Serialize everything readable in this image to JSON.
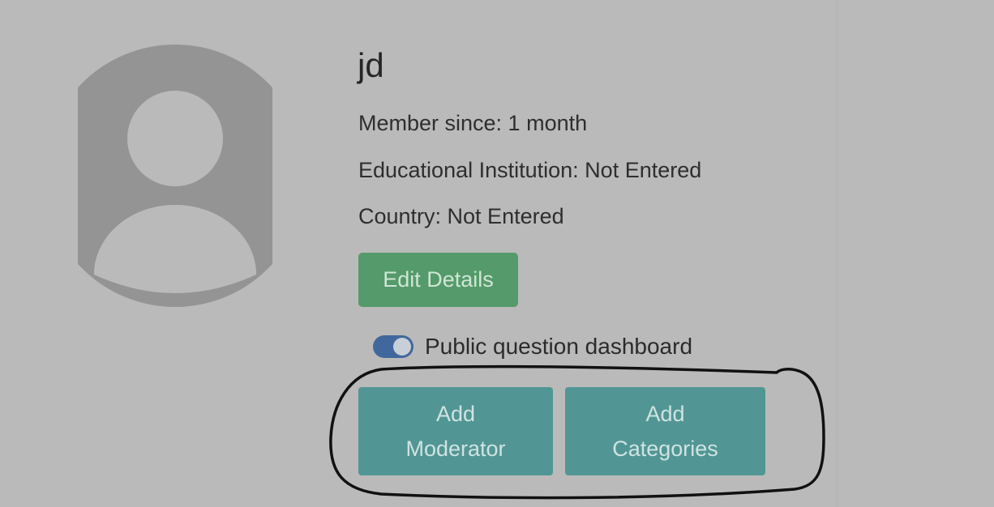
{
  "profile": {
    "username": "jd",
    "member_since": "Member since: 1 month",
    "institution": "Educational Institution: Not Entered",
    "country": "Country: Not Entered"
  },
  "buttons": {
    "edit_details": "Edit Details",
    "add_moderator_line1": "Add",
    "add_moderator_line2": "Moderator",
    "add_categories_line1": "Add",
    "add_categories_line2": "Categories"
  },
  "toggle": {
    "label": "Public question dashboard",
    "state": "on"
  },
  "icons": {
    "avatar": "user-silhouette-icon"
  },
  "colors": {
    "background": "#bababa",
    "edit_button": "#559a6a",
    "action_button": "#519694",
    "toggle_on": "#41689c"
  }
}
